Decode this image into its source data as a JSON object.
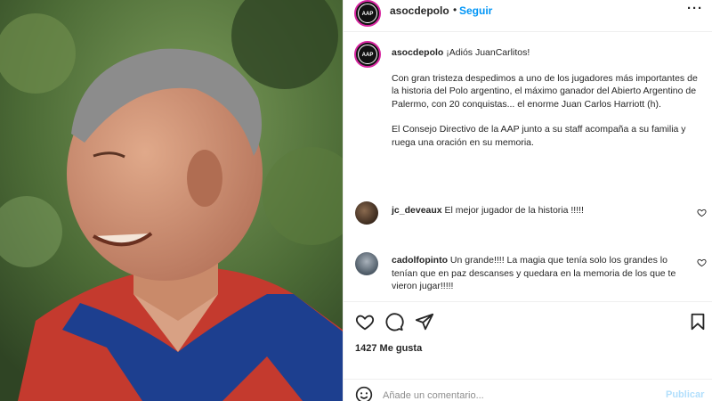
{
  "post": {
    "username": "asocdepolo",
    "follow_dot": "•",
    "follow_label": "Seguir",
    "more_label": "···",
    "avatar_text": "AAP",
    "caption_lines": [
      "¡Adiós JuanCarlitos!",
      "Con gran tristeza despedimos a uno de los jugadores más importantes de la historia del Polo argentino, el máximo ganador del Abierto Argentino de Palermo, con 20 conquistas... el enorme Juan Carlos Harriott (h).",
      "El Consejo Directivo de la AAP junto a su staff acompaña a su familia y ruega una oración en su memoria."
    ]
  },
  "comments": [
    {
      "username": "jc_deveaux",
      "text": "El mejor jugador de la historia !!!!!"
    },
    {
      "username": "cadolfopinto",
      "text": "Un grande!!!! La magia que tenía solo los grandes lo tenían que en paz descanses y quedara en la memoria de los que te vieron jugar!!!!!"
    }
  ],
  "likes": {
    "count_label": "1427 Me gusta"
  },
  "add_comment": {
    "placeholder": "Añade un comentario...",
    "publish_label": "Publicar"
  },
  "icons": {
    "like": "heart-icon",
    "comment": "comment-bubble-icon",
    "share": "paper-plane-icon",
    "save": "bookmark-icon",
    "emoji": "emoji-icon",
    "more": "more-options-icon"
  },
  "colors": {
    "accent": "#0095f6",
    "publish_disabled": "#b2dffc",
    "text": "#262626",
    "muted": "#8e8e8e"
  }
}
